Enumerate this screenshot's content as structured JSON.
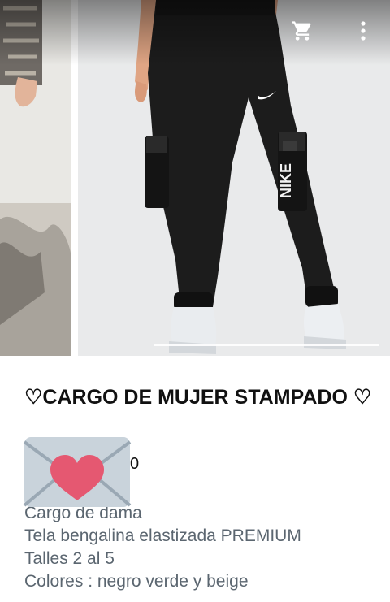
{
  "toolbar": {
    "cart_icon": "shopping-cart-icon",
    "menu_icon": "more-vert-icon"
  },
  "gallery": {
    "progress": 0.5,
    "brand_logo_text": "NIKE"
  },
  "product": {
    "title": "♡CARGO DE MUJER STAMPADO ♡",
    "price_visible_fragment": "0",
    "description_lines": [
      "Cargo de dama",
      "Tela bengalina elastizada PREMIUM",
      "Talles 2 al 5",
      "Colores : negro verde y beige"
    ]
  },
  "overlay": {
    "sticker": "love-letter-icon"
  },
  "colors": {
    "title": "#111111",
    "description": "#5b6670",
    "pants": "#1c1c1c",
    "heart": "#e55871",
    "envelope": "#c9d3db"
  }
}
